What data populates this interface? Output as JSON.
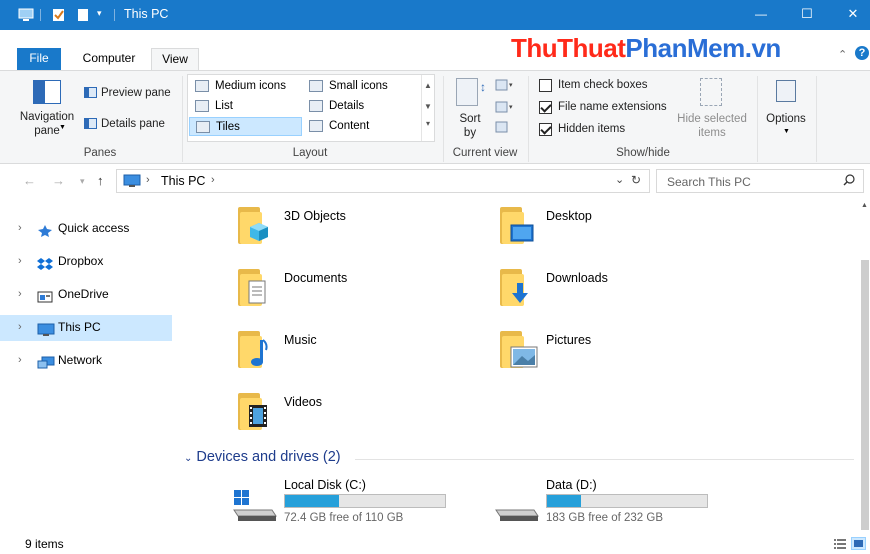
{
  "titlebar": {
    "title": "This PC",
    "minimize_glyph": "—",
    "maximize_glyph": "☐",
    "close_glyph": "✕"
  },
  "watermark": {
    "part1": "ThuThuat",
    "part2": "PhanMem.vn"
  },
  "tabs": [
    {
      "label": "File"
    },
    {
      "label": "Computer"
    },
    {
      "label": "View"
    }
  ],
  "ribbon": {
    "panes": {
      "navigation_pane": "Navigation\npane",
      "preview_pane": "Preview pane",
      "details_pane": "Details pane",
      "group": "Panes"
    },
    "layout": {
      "items": [
        {
          "label": "Medium icons"
        },
        {
          "label": "Small icons"
        },
        {
          "label": "List"
        },
        {
          "label": "Details"
        },
        {
          "label": "Tiles",
          "selected": true
        },
        {
          "label": "Content"
        }
      ],
      "group": "Layout"
    },
    "current_view": {
      "sort_by": "Sort\nby",
      "group": "Current view"
    },
    "show_hide": {
      "item_check_boxes": "Item check boxes",
      "file_name_extensions": "File name extensions",
      "hidden_items": "Hidden items",
      "hide_selected": "Hide selected\nitems",
      "group": "Show/hide",
      "checks": {
        "item_check_boxes": false,
        "file_name_extensions": true,
        "hidden_items": true
      }
    },
    "options": {
      "label": "Options"
    }
  },
  "address": {
    "path": "This PC",
    "search_placeholder": "Search This PC"
  },
  "sidebar": {
    "items": [
      {
        "label": "Quick access",
        "icon": "star-icon"
      },
      {
        "label": "Dropbox",
        "icon": "dropbox-icon"
      },
      {
        "label": "OneDrive",
        "icon": "onedrive-icon"
      },
      {
        "label": "This PC",
        "icon": "computer-icon",
        "selected": true
      },
      {
        "label": "Network",
        "icon": "network-icon"
      }
    ]
  },
  "folders": [
    {
      "name": "3D Objects",
      "icon": "3d-objects-icon"
    },
    {
      "name": "Desktop",
      "icon": "desktop-icon"
    },
    {
      "name": "Documents",
      "icon": "documents-icon"
    },
    {
      "name": "Downloads",
      "icon": "downloads-icon"
    },
    {
      "name": "Music",
      "icon": "music-icon"
    },
    {
      "name": "Pictures",
      "icon": "pictures-icon"
    },
    {
      "name": "Videos",
      "icon": "videos-icon"
    }
  ],
  "devices": {
    "heading": "Devices and drives (2)",
    "drives": [
      {
        "name": "Local Disk (C:)",
        "free_text": "72.4 GB free of 110 GB",
        "used_fraction": 0.34,
        "icon": "windows-drive-icon"
      },
      {
        "name": "Data (D:)",
        "free_text": "183 GB free of 232 GB",
        "used_fraction": 0.21,
        "icon": "drive-icon"
      }
    ]
  },
  "status": {
    "items_count": "9 items"
  },
  "colors": {
    "accent": "#1979ca",
    "selection": "#cce8ff",
    "drive_bar": "#26a0da",
    "folder": "#ffd86a"
  }
}
